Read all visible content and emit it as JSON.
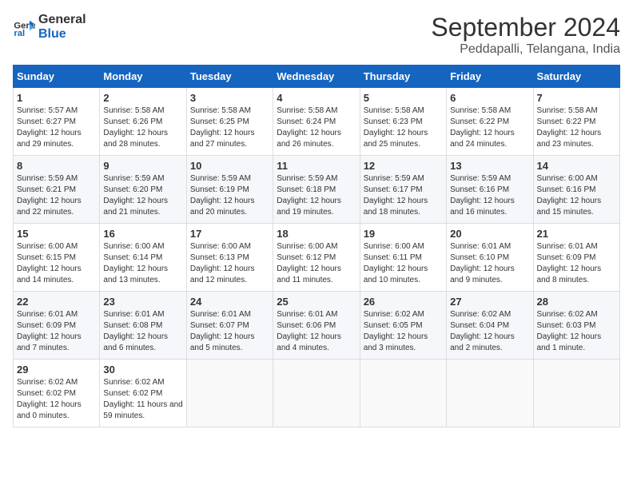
{
  "logo": {
    "line1": "General",
    "line2": "Blue"
  },
  "title": "September 2024",
  "location": "Peddapalli, Telangana, India",
  "weekdays": [
    "Sunday",
    "Monday",
    "Tuesday",
    "Wednesday",
    "Thursday",
    "Friday",
    "Saturday"
  ],
  "weeks": [
    [
      {
        "day": 1,
        "sunrise": "5:57 AM",
        "sunset": "6:27 PM",
        "daylight": "12 hours and 29 minutes."
      },
      {
        "day": 2,
        "sunrise": "5:58 AM",
        "sunset": "6:26 PM",
        "daylight": "12 hours and 28 minutes."
      },
      {
        "day": 3,
        "sunrise": "5:58 AM",
        "sunset": "6:25 PM",
        "daylight": "12 hours and 27 minutes."
      },
      {
        "day": 4,
        "sunrise": "5:58 AM",
        "sunset": "6:24 PM",
        "daylight": "12 hours and 26 minutes."
      },
      {
        "day": 5,
        "sunrise": "5:58 AM",
        "sunset": "6:23 PM",
        "daylight": "12 hours and 25 minutes."
      },
      {
        "day": 6,
        "sunrise": "5:58 AM",
        "sunset": "6:22 PM",
        "daylight": "12 hours and 24 minutes."
      },
      {
        "day": 7,
        "sunrise": "5:58 AM",
        "sunset": "6:22 PM",
        "daylight": "12 hours and 23 minutes."
      }
    ],
    [
      {
        "day": 8,
        "sunrise": "5:59 AM",
        "sunset": "6:21 PM",
        "daylight": "12 hours and 22 minutes."
      },
      {
        "day": 9,
        "sunrise": "5:59 AM",
        "sunset": "6:20 PM",
        "daylight": "12 hours and 21 minutes."
      },
      {
        "day": 10,
        "sunrise": "5:59 AM",
        "sunset": "6:19 PM",
        "daylight": "12 hours and 20 minutes."
      },
      {
        "day": 11,
        "sunrise": "5:59 AM",
        "sunset": "6:18 PM",
        "daylight": "12 hours and 19 minutes."
      },
      {
        "day": 12,
        "sunrise": "5:59 AM",
        "sunset": "6:17 PM",
        "daylight": "12 hours and 18 minutes."
      },
      {
        "day": 13,
        "sunrise": "5:59 AM",
        "sunset": "6:16 PM",
        "daylight": "12 hours and 16 minutes."
      },
      {
        "day": 14,
        "sunrise": "6:00 AM",
        "sunset": "6:16 PM",
        "daylight": "12 hours and 15 minutes."
      }
    ],
    [
      {
        "day": 15,
        "sunrise": "6:00 AM",
        "sunset": "6:15 PM",
        "daylight": "12 hours and 14 minutes."
      },
      {
        "day": 16,
        "sunrise": "6:00 AM",
        "sunset": "6:14 PM",
        "daylight": "12 hours and 13 minutes."
      },
      {
        "day": 17,
        "sunrise": "6:00 AM",
        "sunset": "6:13 PM",
        "daylight": "12 hours and 12 minutes."
      },
      {
        "day": 18,
        "sunrise": "6:00 AM",
        "sunset": "6:12 PM",
        "daylight": "12 hours and 11 minutes."
      },
      {
        "day": 19,
        "sunrise": "6:00 AM",
        "sunset": "6:11 PM",
        "daylight": "12 hours and 10 minutes."
      },
      {
        "day": 20,
        "sunrise": "6:01 AM",
        "sunset": "6:10 PM",
        "daylight": "12 hours and 9 minutes."
      },
      {
        "day": 21,
        "sunrise": "6:01 AM",
        "sunset": "6:09 PM",
        "daylight": "12 hours and 8 minutes."
      }
    ],
    [
      {
        "day": 22,
        "sunrise": "6:01 AM",
        "sunset": "6:09 PM",
        "daylight": "12 hours and 7 minutes."
      },
      {
        "day": 23,
        "sunrise": "6:01 AM",
        "sunset": "6:08 PM",
        "daylight": "12 hours and 6 minutes."
      },
      {
        "day": 24,
        "sunrise": "6:01 AM",
        "sunset": "6:07 PM",
        "daylight": "12 hours and 5 minutes."
      },
      {
        "day": 25,
        "sunrise": "6:01 AM",
        "sunset": "6:06 PM",
        "daylight": "12 hours and 4 minutes."
      },
      {
        "day": 26,
        "sunrise": "6:02 AM",
        "sunset": "6:05 PM",
        "daylight": "12 hours and 3 minutes."
      },
      {
        "day": 27,
        "sunrise": "6:02 AM",
        "sunset": "6:04 PM",
        "daylight": "12 hours and 2 minutes."
      },
      {
        "day": 28,
        "sunrise": "6:02 AM",
        "sunset": "6:03 PM",
        "daylight": "12 hours and 1 minute."
      }
    ],
    [
      {
        "day": 29,
        "sunrise": "6:02 AM",
        "sunset": "6:02 PM",
        "daylight": "12 hours and 0 minutes."
      },
      {
        "day": 30,
        "sunrise": "6:02 AM",
        "sunset": "6:02 PM",
        "daylight": "11 hours and 59 minutes."
      },
      null,
      null,
      null,
      null,
      null
    ]
  ]
}
